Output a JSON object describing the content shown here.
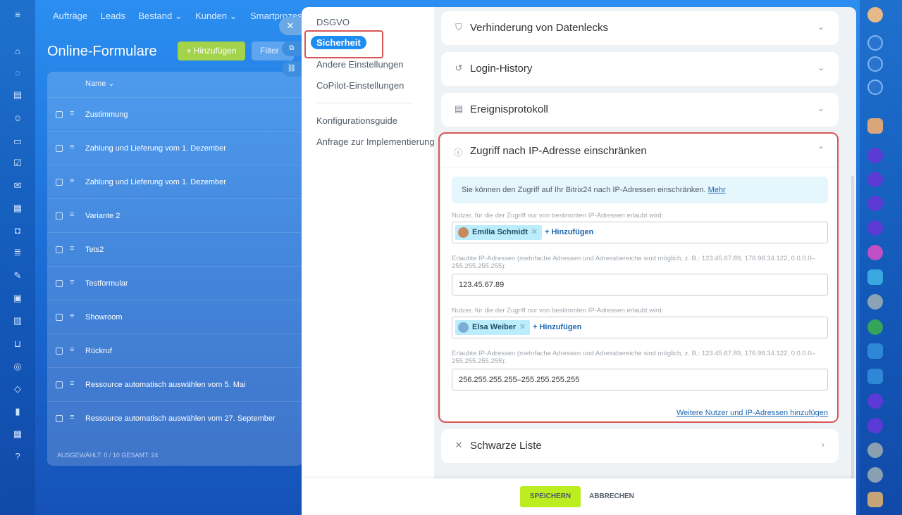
{
  "topnav": [
    "Aufträge",
    "Leads",
    "Bestand ⌄",
    "Kunden ⌄",
    "Smartprozesse ⌄"
  ],
  "background": {
    "page_title": "Online-Formulare",
    "add_button": "+ Hinzufügen",
    "filter_placeholder": "Filter",
    "table_header": "Name ⌄",
    "rows": [
      "Zustimmung",
      "Zahlung und Lieferung vom 1. Dezember",
      "Zahlung und Lieferung vom 1. Dezember",
      "Variante 2",
      "Tets2",
      "Testformular",
      "Showroom",
      "Rückruf",
      "Ressource automatisch auswählen vom 5. Mai",
      "Ressource automatisch auswählen vom 27. September"
    ],
    "footer": "AUSGEWÄHLT: 0 / 10     GESAMT: 24"
  },
  "nav": {
    "items": [
      "DSGVO",
      "Sicherheit",
      "Andere Einstellungen",
      "CoPilot-Einstellungen",
      "Konfigurationsguide",
      "Anfrage zur Implementierung"
    ]
  },
  "sections": {
    "leak": "Verhinderung von Datenlecks",
    "login": "Login-History",
    "events": "Ereignisprotokoll",
    "ip": "Zugriff nach IP-Adresse einschränken",
    "blacklist": "Schwarze Liste"
  },
  "ip": {
    "info_text": "Sie können den Zugriff auf Ihr Bitrix24 nach IP-Adressen einschränken.",
    "info_link": "Mehr",
    "users_label": "Nutzer, für die der Zugriff nur von bestimmten IP-Adressen erlaubt wird:",
    "ips_label": "Erlaubte IP-Adressen (mehrfache Adressen und Adressbereiche sind möglich, z. B.: 123.45.67.89, 176.98.34.122, 0.0.0.0–255.255.255.255):",
    "user1": "Emilia Schmidt",
    "ip1": "123.45.67.89",
    "user2": "Elsa Weiber",
    "ip2": "256.255.255.255–255.255.255.255",
    "add_label": "+ Hinzufügen",
    "more_link": "Weitere Nutzer und IP-Adressen hinzufügen"
  },
  "footer": {
    "save": "SPEICHERN",
    "cancel": "ABBRECHEN"
  },
  "colors": {
    "accent_blue": "#1f8cf2",
    "save_green": "#bbed21",
    "highlight_red": "#d95656"
  }
}
